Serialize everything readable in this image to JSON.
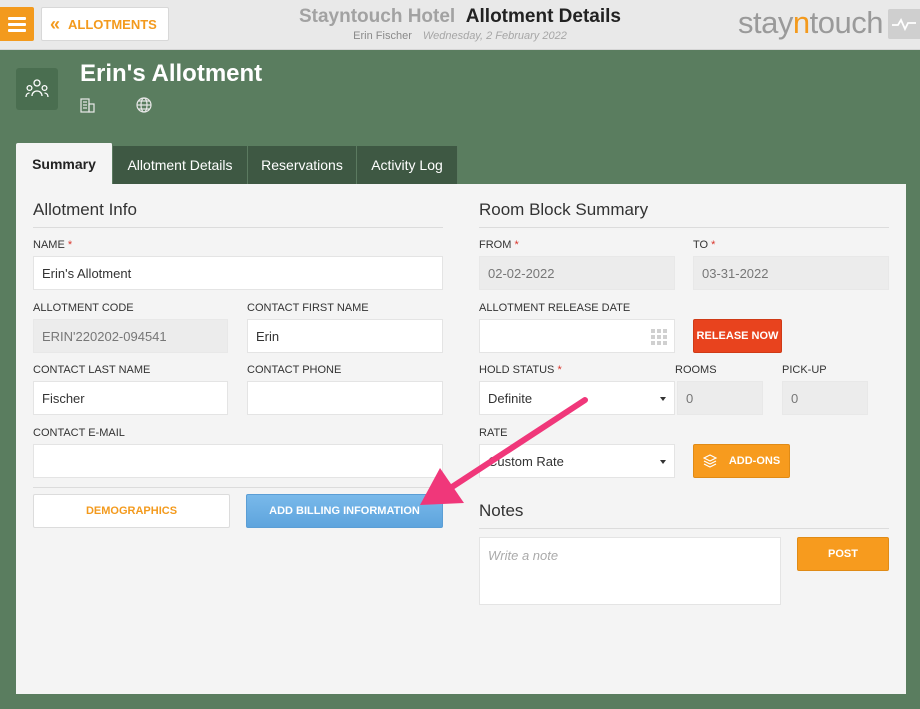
{
  "header": {
    "back_label": "ALLOTMENTS",
    "hotel_name": "Stayntouch Hotel",
    "page_title": "Allotment Details",
    "user_name": "Erin Fischer",
    "date": "Wednesday, 2 February 2022",
    "logo_pre": "stay",
    "logo_n": "n",
    "logo_post": "touch"
  },
  "allotment": {
    "title": "Erin's Allotment"
  },
  "tabs": [
    {
      "label": "Summary"
    },
    {
      "label": "Allotment Details"
    },
    {
      "label": "Reservations"
    },
    {
      "label": "Activity Log"
    }
  ],
  "allotment_info": {
    "section_title": "Allotment Info",
    "name_label": "NAME",
    "name_value": "Erin's Allotment",
    "code_label": "ALLOTMENT CODE",
    "code_value": "ERIN'220202-094541",
    "first_name_label": "CONTACT FIRST NAME",
    "first_name_value": "Erin",
    "last_name_label": "CONTACT LAST NAME",
    "last_name_value": "Fischer",
    "phone_label": "CONTACT PHONE",
    "phone_value": "",
    "email_label": "CONTACT E-MAIL",
    "email_value": "",
    "demographics_label": "DEMOGRAPHICS",
    "billing_label": "ADD BILLING INFORMATION"
  },
  "room_block": {
    "section_title": "Room Block Summary",
    "from_label": "FROM",
    "from_value": "02-02-2022",
    "to_label": "TO",
    "to_value": "03-31-2022",
    "release_date_label": "ALLOTMENT RELEASE DATE",
    "release_date_value": "",
    "release_now_label": "RELEASE NOW",
    "hold_status_label": "HOLD STATUS",
    "hold_status_value": "Definite",
    "rooms_label": "ROOMS",
    "rooms_value": "0",
    "pickup_label": "PICK-UP",
    "pickup_value": "0",
    "rate_label": "RATE",
    "rate_value": "Custom Rate",
    "addons_label": "ADD-ONS"
  },
  "notes": {
    "section_title": "Notes",
    "placeholder": "Write a note",
    "post_label": "POST"
  },
  "colors": {
    "accent": "#f39a1d",
    "background": "#5a7d5f",
    "tab_dark": "#3e5843",
    "release_red": "#e8431e",
    "billing_blue": "#6aaee3",
    "annotation_arrow": "#f0377a"
  }
}
